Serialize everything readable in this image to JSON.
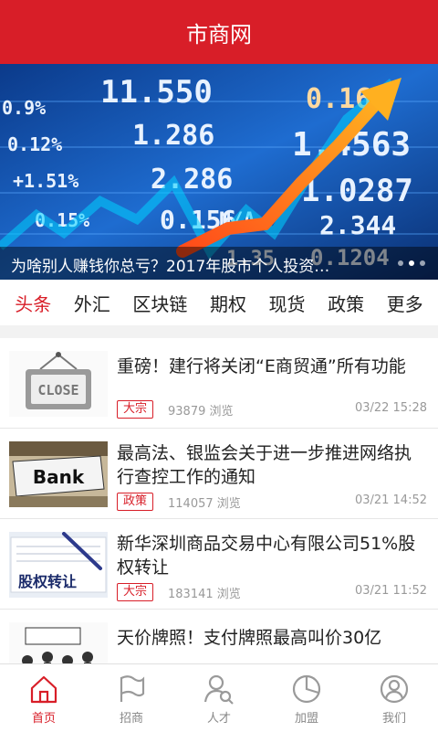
{
  "app": {
    "title": "市商网"
  },
  "banner": {
    "caption": "为啥别人赚钱你总亏？2017年股市个人投资…",
    "board_numbers": [
      "11.550",
      "1.286",
      "2.286",
      "0.156",
      "1.4563",
      "1.0287",
      "2.344",
      "0.1204",
      "0.168",
      "0.9%",
      "0.12%",
      "+1.51%",
      "0.15%",
      "N/A",
      "1.35"
    ]
  },
  "tabs": [
    "头条",
    "外汇",
    "区块链",
    "期权",
    "现货",
    "政策",
    "更多"
  ],
  "articles": [
    {
      "title": "重磅！建行将关闭“E商贸通”所有功能",
      "tag": "大宗",
      "views": "93879 浏览",
      "date": "03/22 15:28",
      "thumb_text": "CLOSE"
    },
    {
      "title": "最高法、银监会关于进一步推进网络执行查控工作的通知",
      "tag": "政策",
      "views": "114057 浏览",
      "date": "03/21 14:52",
      "thumb_text": "Bank"
    },
    {
      "title": "新华深圳商品交易中心有限公司51%股权转让",
      "tag": "大宗",
      "views": "183141 浏览",
      "date": "03/21 11:52",
      "thumb_text": "股权转让"
    },
    {
      "title": "天价牌照！支付牌照最高叫价30亿"
    }
  ],
  "nav": [
    {
      "label": "首页",
      "icon": "home-icon"
    },
    {
      "label": "招商",
      "icon": "flag-icon"
    },
    {
      "label": "人才",
      "icon": "user-search-icon"
    },
    {
      "label": "加盟",
      "icon": "pie-chart-icon"
    },
    {
      "label": "我们",
      "icon": "user-circle-icon"
    }
  ],
  "colors": {
    "brand": "#d81e28",
    "muted": "#999999"
  }
}
